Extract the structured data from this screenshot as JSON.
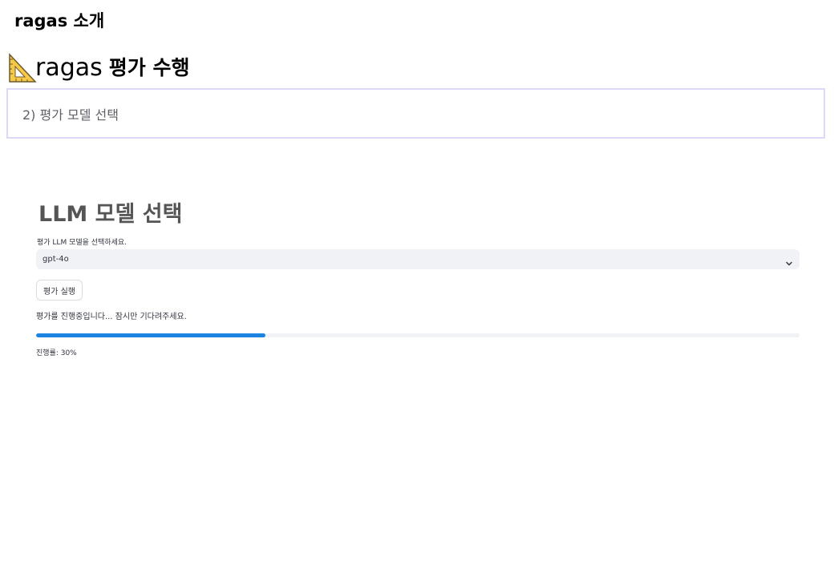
{
  "page": {
    "title": "ragas 소개"
  },
  "eval_header": {
    "icon": "triangular-ruler-icon",
    "text": "ragas",
    "bold_text": "평가 수행"
  },
  "step": {
    "label": "2) 평가 모델 선택"
  },
  "model_section": {
    "title": "LLM 모델 선택",
    "select_label": "평가 LLM 모델을 선택하세요.",
    "selected_model": "gpt-4o",
    "run_button_label": "평가 실행",
    "status_text": "평가를 진행중입니다... 잠시만 기다려주세요.",
    "progress_label": "진행률: 30%",
    "progress": 0.3
  },
  "colors": {
    "accent": "#1c83e1",
    "step_border": "#dcd8f7",
    "input_bg": "#f0f2f6"
  }
}
